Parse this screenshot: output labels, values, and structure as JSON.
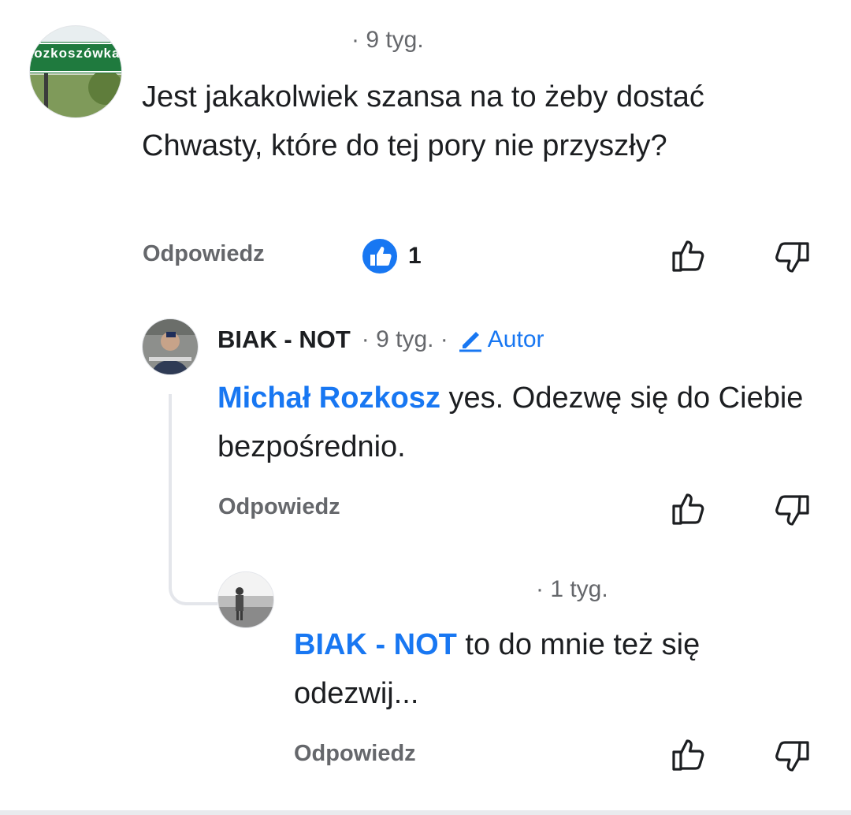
{
  "comment1": {
    "avatar_text": "Rozkoszówka",
    "time": "· 9 tyg.",
    "text": "Jest jakakolwiek szansa na to żeby dostać Chwasty, które do tej pory nie przyszły?",
    "reply_label": "Odpowiedz",
    "like_count": "1"
  },
  "comment2": {
    "author": "BIAK - NOT",
    "time": "· 9 tyg. ·",
    "badge": "Autor",
    "mention": "Michał Rozkosz",
    "text": " yes. Odezwę się do Ciebie bezpośrednio.",
    "reply_label": "Odpowiedz"
  },
  "comment3": {
    "time": "· 1 tyg.",
    "mention": "BIAK - NOT",
    "text": " to do mnie też się odezwij...",
    "reply_label": "Odpowiedz"
  },
  "colors": {
    "accent": "#1877f2",
    "muted": "#65676b",
    "text": "#1c1e21"
  }
}
